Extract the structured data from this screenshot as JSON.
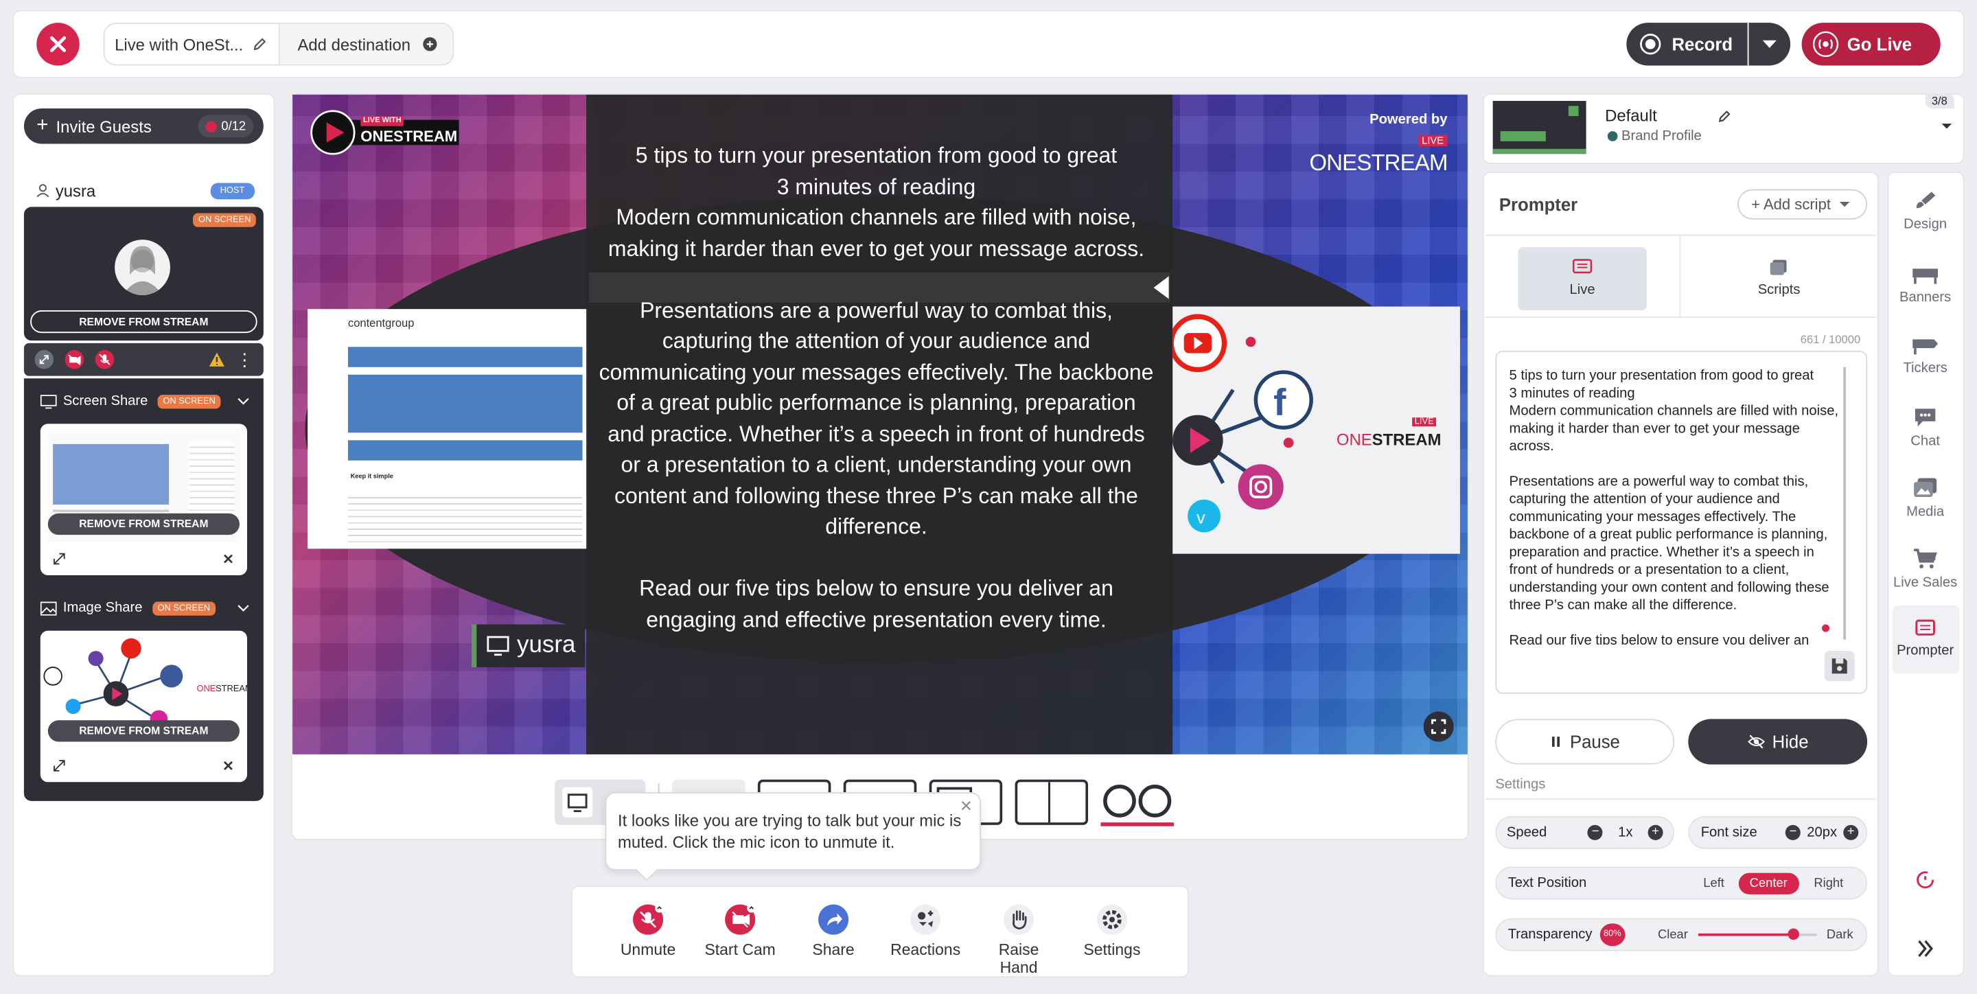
{
  "topbar": {
    "title": "Live with OneSt...",
    "add_destination": "Add destination",
    "record": "Record",
    "go_live": "Go Live"
  },
  "left": {
    "invite": "Invite Guests",
    "guest_count": "0/12",
    "host_name": "yusra",
    "host_badge": "HOST",
    "on_screen": "ON SCREEN",
    "remove": "REMOVE FROM STREAM",
    "screen_share": "Screen Share",
    "image_share": "Image Share"
  },
  "stage": {
    "logo_small": "LIVE WITH",
    "logo_big": "ONESTREAM",
    "powered_by": "Powered by",
    "powered_brand": "ONESTREAM",
    "live_tag": "LIVE",
    "name_tag": "yusra",
    "thumb_site": "contentgroup",
    "thumb_heading": "Keep it simple"
  },
  "overlay": {
    "p1": "5 tips to turn your presentation from good to great\n3 minutes of reading\nModern communication channels are filled with noise, making it harder than ever to get your message across.",
    "p2": "Presentations are a powerful way to combat this, capturing the attention of your audience and communicating your messages effectively. The backbone of a great public performance is planning, preparation and practice. Whether it’s a speech in front of hundreds or a presentation to a client, understanding your own content and following these three P’s can make all the difference.",
    "p3": "Read our five tips below to ensure you deliver an engaging and effective presentation every time."
  },
  "tooltip": {
    "text": "It looks like you are trying to talk but your mic is muted. Click the mic icon to unmute it.",
    "close": "×"
  },
  "controls": [
    {
      "label": "Unmute"
    },
    {
      "label": "Start Cam"
    },
    {
      "label": "Share"
    },
    {
      "label": "Reactions"
    },
    {
      "label": "Raise Hand"
    },
    {
      "label": "Settings"
    }
  ],
  "brand": {
    "name": "Default",
    "sub": "Brand Profile",
    "count": "3/8"
  },
  "prompter": {
    "title": "Prompter",
    "add_script": "+ Add script",
    "tab_live": "Live",
    "tab_scripts": "Scripts",
    "char_count": "661 / 10000",
    "text": "5 tips to turn your presentation from good to great\n3 minutes of reading\nModern communication channels are filled with noise, making it harder than ever to get your message across.\n\nPresentations are a powerful way to combat this, capturing the attention of your audience and communicating your messages effectively. The backbone of a great public performance is planning, preparation and practice. Whether it’s a speech in front of hundreds or a presentation to a client, understanding your own content and following these three P’s can make all the difference.\n\nRead our five tips below to ensure you deliver an",
    "pause": "Pause",
    "hide": "Hide",
    "settings_label": "Settings",
    "speed_label": "Speed",
    "speed_value": "1x",
    "fontsize_label": "Font size",
    "fontsize_value": "20px",
    "textpos_label": "Text Position",
    "pos_left": "Left",
    "pos_center": "Center",
    "pos_right": "Right",
    "transparency_label": "Transparency",
    "transparency_value": "80%",
    "clear": "Clear",
    "dark": "Dark",
    "transparency_level": 0.8
  },
  "sidebar": [
    {
      "label": "Design"
    },
    {
      "label": "Banners"
    },
    {
      "label": "Tickers"
    },
    {
      "label": "Chat"
    },
    {
      "label": "Media"
    },
    {
      "label": "Live Sales"
    },
    {
      "label": "Prompter"
    }
  ],
  "colors": {
    "accent": "#d7264e",
    "dark": "#2e2f36",
    "highlight": "#3c6fb8"
  }
}
